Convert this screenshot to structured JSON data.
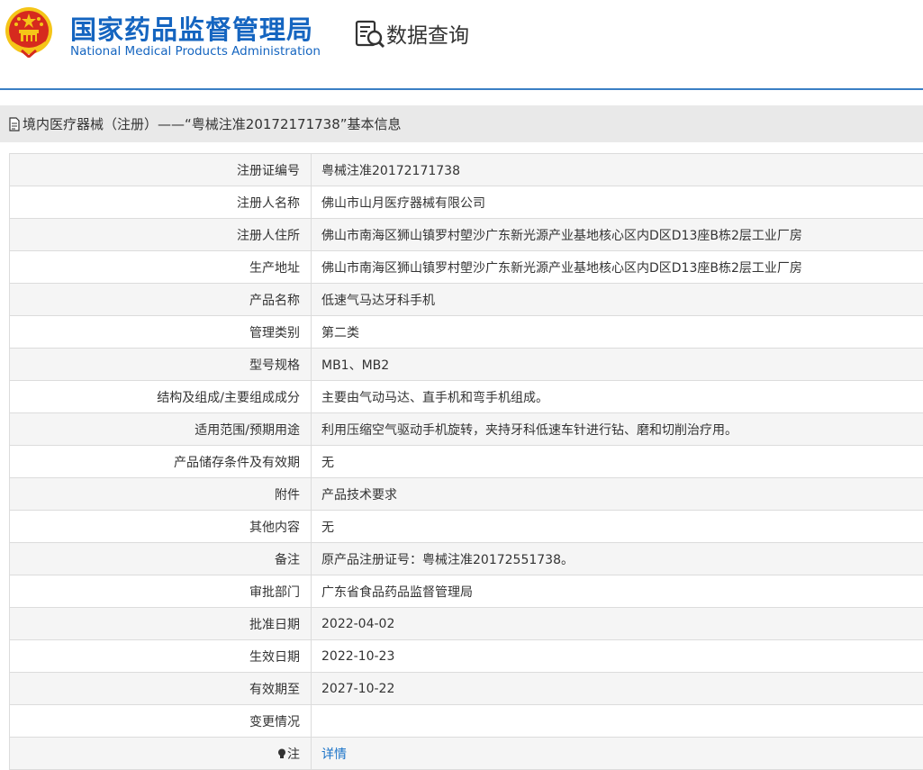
{
  "header": {
    "org_name_cn": "国家药品监督管理局",
    "org_name_en": "National Medical Products Administration",
    "data_query_label": "数据查询"
  },
  "page_title": "境内医疗器械（注册）——“粤械注准20172171738”基本信息",
  "rows": [
    {
      "label": "注册证编号",
      "value": "粤械注准20172171738"
    },
    {
      "label": "注册人名称",
      "value": "佛山市山月医疗器械有限公司"
    },
    {
      "label": "注册人住所",
      "value": "佛山市南海区狮山镇罗村塱沙广东新光源产业基地核心区内D区D13座B栋2层工业厂房"
    },
    {
      "label": "生产地址",
      "value": "佛山市南海区狮山镇罗村塱沙广东新光源产业基地核心区内D区D13座B栋2层工业厂房"
    },
    {
      "label": "产品名称",
      "value": "低速气马达牙科手机"
    },
    {
      "label": "管理类别",
      "value": "第二类"
    },
    {
      "label": "型号规格",
      "value": "MB1、MB2"
    },
    {
      "label": "结构及组成/主要组成成分",
      "value": "主要由气动马达、直手机和弯手机组成。"
    },
    {
      "label": "适用范围/预期用途",
      "value": "利用压缩空气驱动手机旋转，夹持牙科低速车针进行钻、磨和切削治疗用。"
    },
    {
      "label": "产品储存条件及有效期",
      "value": "无"
    },
    {
      "label": "附件",
      "value": "产品技术要求"
    },
    {
      "label": "其他内容",
      "value": "无"
    },
    {
      "label": "备注",
      "value": "原产品注册证号：粤械注准20172551738。"
    },
    {
      "label": "审批部门",
      "value": "广东省食品药品监督管理局"
    },
    {
      "label": "批准日期",
      "value": "2022-04-02"
    },
    {
      "label": "生效日期",
      "value": "2022-10-23"
    },
    {
      "label": "有效期至",
      "value": "2027-10-22"
    },
    {
      "label": "变更情况",
      "value": ""
    }
  ],
  "note_row": {
    "label": "注",
    "link_text": "详情"
  },
  "colors": {
    "brand_blue": "#1565c0",
    "divider": "#3a7fc4",
    "link": "#1a73c8"
  },
  "icons": [
    "national-emblem-icon",
    "data-query-icon",
    "document-icon",
    "lightbulb-icon"
  ]
}
